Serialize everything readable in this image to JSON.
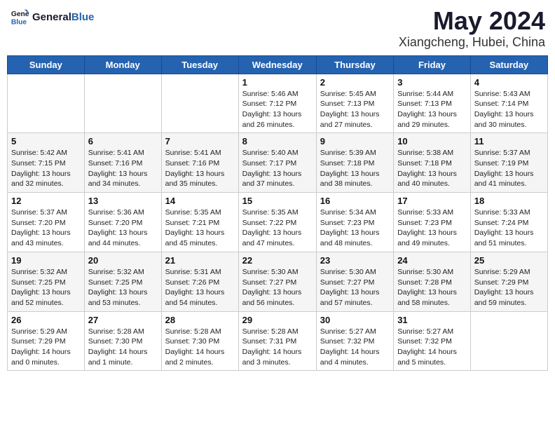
{
  "logo": {
    "text_general": "General",
    "text_blue": "Blue"
  },
  "title": "May 2024",
  "subtitle": "Xiangcheng, Hubei, China",
  "weekdays": [
    "Sunday",
    "Monday",
    "Tuesday",
    "Wednesday",
    "Thursday",
    "Friday",
    "Saturday"
  ],
  "weeks": [
    [
      {
        "day": "",
        "info": ""
      },
      {
        "day": "",
        "info": ""
      },
      {
        "day": "",
        "info": ""
      },
      {
        "day": "1",
        "info": "Sunrise: 5:46 AM\nSunset: 7:12 PM\nDaylight: 13 hours\nand 26 minutes."
      },
      {
        "day": "2",
        "info": "Sunrise: 5:45 AM\nSunset: 7:13 PM\nDaylight: 13 hours\nand 27 minutes."
      },
      {
        "day": "3",
        "info": "Sunrise: 5:44 AM\nSunset: 7:13 PM\nDaylight: 13 hours\nand 29 minutes."
      },
      {
        "day": "4",
        "info": "Sunrise: 5:43 AM\nSunset: 7:14 PM\nDaylight: 13 hours\nand 30 minutes."
      }
    ],
    [
      {
        "day": "5",
        "info": "Sunrise: 5:42 AM\nSunset: 7:15 PM\nDaylight: 13 hours\nand 32 minutes."
      },
      {
        "day": "6",
        "info": "Sunrise: 5:41 AM\nSunset: 7:16 PM\nDaylight: 13 hours\nand 34 minutes."
      },
      {
        "day": "7",
        "info": "Sunrise: 5:41 AM\nSunset: 7:16 PM\nDaylight: 13 hours\nand 35 minutes."
      },
      {
        "day": "8",
        "info": "Sunrise: 5:40 AM\nSunset: 7:17 PM\nDaylight: 13 hours\nand 37 minutes."
      },
      {
        "day": "9",
        "info": "Sunrise: 5:39 AM\nSunset: 7:18 PM\nDaylight: 13 hours\nand 38 minutes."
      },
      {
        "day": "10",
        "info": "Sunrise: 5:38 AM\nSunset: 7:18 PM\nDaylight: 13 hours\nand 40 minutes."
      },
      {
        "day": "11",
        "info": "Sunrise: 5:37 AM\nSunset: 7:19 PM\nDaylight: 13 hours\nand 41 minutes."
      }
    ],
    [
      {
        "day": "12",
        "info": "Sunrise: 5:37 AM\nSunset: 7:20 PM\nDaylight: 13 hours\nand 43 minutes."
      },
      {
        "day": "13",
        "info": "Sunrise: 5:36 AM\nSunset: 7:20 PM\nDaylight: 13 hours\nand 44 minutes."
      },
      {
        "day": "14",
        "info": "Sunrise: 5:35 AM\nSunset: 7:21 PM\nDaylight: 13 hours\nand 45 minutes."
      },
      {
        "day": "15",
        "info": "Sunrise: 5:35 AM\nSunset: 7:22 PM\nDaylight: 13 hours\nand 47 minutes."
      },
      {
        "day": "16",
        "info": "Sunrise: 5:34 AM\nSunset: 7:23 PM\nDaylight: 13 hours\nand 48 minutes."
      },
      {
        "day": "17",
        "info": "Sunrise: 5:33 AM\nSunset: 7:23 PM\nDaylight: 13 hours\nand 49 minutes."
      },
      {
        "day": "18",
        "info": "Sunrise: 5:33 AM\nSunset: 7:24 PM\nDaylight: 13 hours\nand 51 minutes."
      }
    ],
    [
      {
        "day": "19",
        "info": "Sunrise: 5:32 AM\nSunset: 7:25 PM\nDaylight: 13 hours\nand 52 minutes."
      },
      {
        "day": "20",
        "info": "Sunrise: 5:32 AM\nSunset: 7:25 PM\nDaylight: 13 hours\nand 53 minutes."
      },
      {
        "day": "21",
        "info": "Sunrise: 5:31 AM\nSunset: 7:26 PM\nDaylight: 13 hours\nand 54 minutes."
      },
      {
        "day": "22",
        "info": "Sunrise: 5:30 AM\nSunset: 7:27 PM\nDaylight: 13 hours\nand 56 minutes."
      },
      {
        "day": "23",
        "info": "Sunrise: 5:30 AM\nSunset: 7:27 PM\nDaylight: 13 hours\nand 57 minutes."
      },
      {
        "day": "24",
        "info": "Sunrise: 5:30 AM\nSunset: 7:28 PM\nDaylight: 13 hours\nand 58 minutes."
      },
      {
        "day": "25",
        "info": "Sunrise: 5:29 AM\nSunset: 7:29 PM\nDaylight: 13 hours\nand 59 minutes."
      }
    ],
    [
      {
        "day": "26",
        "info": "Sunrise: 5:29 AM\nSunset: 7:29 PM\nDaylight: 14 hours\nand 0 minutes."
      },
      {
        "day": "27",
        "info": "Sunrise: 5:28 AM\nSunset: 7:30 PM\nDaylight: 14 hours\nand 1 minute."
      },
      {
        "day": "28",
        "info": "Sunrise: 5:28 AM\nSunset: 7:30 PM\nDaylight: 14 hours\nand 2 minutes."
      },
      {
        "day": "29",
        "info": "Sunrise: 5:28 AM\nSunset: 7:31 PM\nDaylight: 14 hours\nand 3 minutes."
      },
      {
        "day": "30",
        "info": "Sunrise: 5:27 AM\nSunset: 7:32 PM\nDaylight: 14 hours\nand 4 minutes."
      },
      {
        "day": "31",
        "info": "Sunrise: 5:27 AM\nSunset: 7:32 PM\nDaylight: 14 hours\nand 5 minutes."
      },
      {
        "day": "",
        "info": ""
      }
    ]
  ]
}
